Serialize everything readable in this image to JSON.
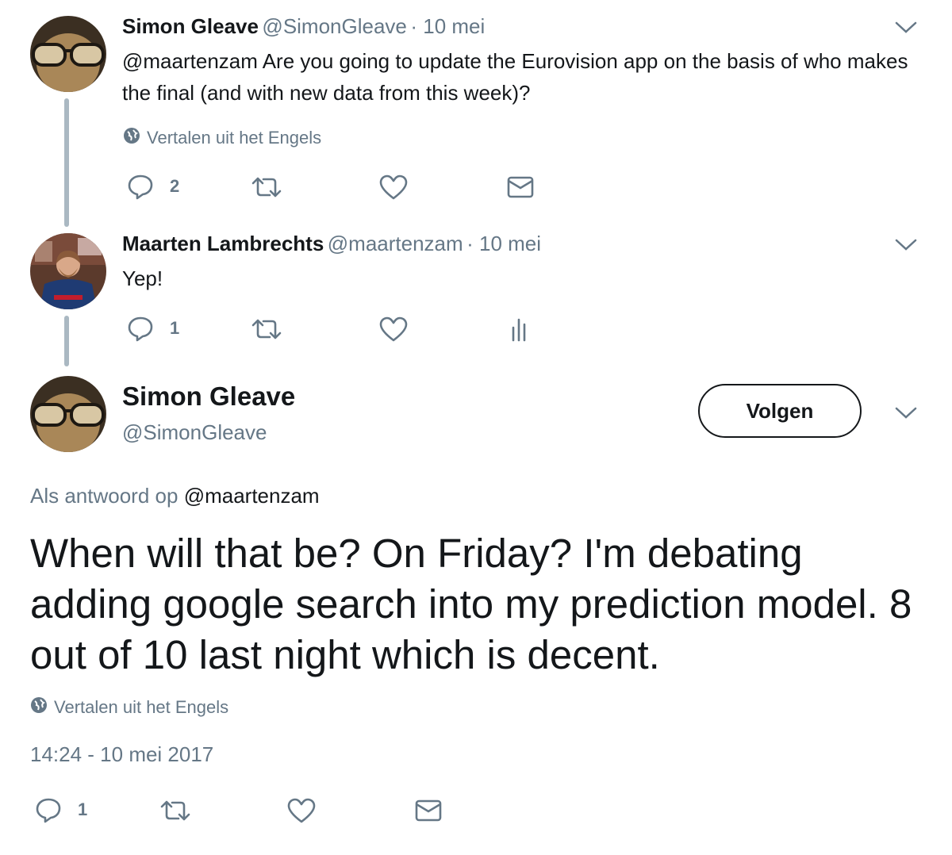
{
  "thread": [
    {
      "name": "Simon Gleave",
      "handle": "@SimonGleave",
      "date": "· 10 mei",
      "mention": "@maartenzam",
      "text": "Are you going to update the Eurovision app on the basis of who makes the final (and with new data from this week)?",
      "translate": "Vertalen uit het Engels",
      "reply_count": "2"
    },
    {
      "name": "Maarten Lambrechts",
      "handle": "@maartenzam",
      "date": "· 10 mei",
      "text": "Yep!",
      "reply_count": "1"
    }
  ],
  "main_tweet": {
    "name": "Simon Gleave",
    "handle": "@SimonGleave",
    "follow_label": "Volgen",
    "reply_prefix": "Als antwoord op",
    "reply_to": "@maartenzam",
    "text": "When will that be? On Friday? I'm debating adding google search into my prediction model. 8 out of 10 last night which is decent.",
    "translate": "Vertalen uit het Engels",
    "timestamp": "14:24 - 10 mei 2017",
    "reply_count": "1"
  },
  "icons": [
    "reply-icon",
    "retweet-icon",
    "like-icon",
    "direct-message-icon",
    "analytics-icon",
    "globe-icon",
    "chevron-down-icon"
  ],
  "colors": {
    "text": "#14171a",
    "muted": "#657786",
    "thread_line": "#aab8c2"
  }
}
